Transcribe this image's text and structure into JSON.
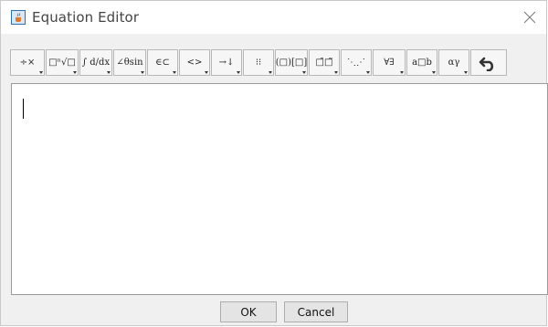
{
  "window": {
    "title": "Equation Editor"
  },
  "toolbar": {
    "buttons": [
      {
        "name": "arithmetic-operators-button",
        "label": "÷×"
      },
      {
        "name": "roots-button",
        "label": "□ⁿ√□"
      },
      {
        "name": "calculus-button",
        "label": "∫ d/dx"
      },
      {
        "name": "functions-button",
        "label": "∠θsin"
      },
      {
        "name": "set-operators-button",
        "label": "∈⊂"
      },
      {
        "name": "relations-button",
        "label": "<>"
      },
      {
        "name": "arrows-button",
        "label": "→↓"
      },
      {
        "name": "matrix-button",
        "label": "⁝⁝"
      },
      {
        "name": "brackets-button",
        "label": "(□)[□]"
      },
      {
        "name": "accents-button",
        "label": "□̄□̃"
      },
      {
        "name": "dots-button",
        "label": "⋱⋰"
      },
      {
        "name": "logic-button",
        "label": "∀∃"
      },
      {
        "name": "spacing-button",
        "label": "a□b"
      },
      {
        "name": "greek-letters-button",
        "label": "αγ"
      }
    ],
    "undo_icon": "undo-icon"
  },
  "footer": {
    "ok_label": "OK",
    "cancel_label": "Cancel"
  }
}
